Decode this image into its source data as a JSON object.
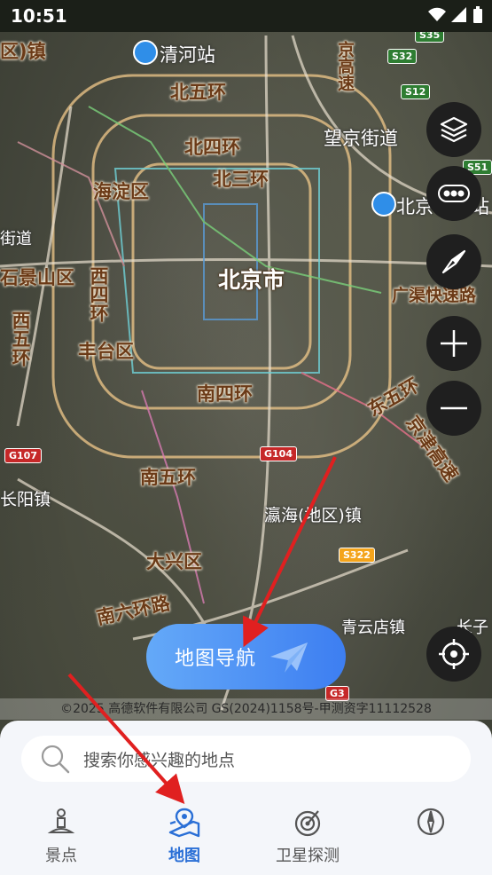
{
  "status_bar": {
    "time": "10:51"
  },
  "map": {
    "places": {
      "qinghe_station": "清河站",
      "north_5th_ring": "北五环",
      "north_4th_ring": "北四环",
      "north_3rd_ring": "北三环",
      "haidian": "海淀区",
      "beijing_city": "北京市",
      "shijingshan": "石景山区",
      "west_4th_ring": "西四环",
      "west_5th_ring": "西五环",
      "fengtai": "丰台区",
      "south_4th_ring": "南四环",
      "south_5th_ring": "南五环",
      "south_6th_ring": "南六环路",
      "daxing": "大兴区",
      "east_5th_ring": "东五环",
      "jingjin_highway": "京津高速",
      "guangqu_expressway": "广渠快速路",
      "wangjing_street": "望京街道",
      "beijing_chaoyang_station": "北京朝阳站",
      "yinghai": "瀛海(地区)镇",
      "changyang": "长阳镇",
      "qingyundian": "青云店镇",
      "changzi": "长子",
      "jingshi_highway": "京高速",
      "top_left_partial": "区)镇",
      "street_partial": "街道"
    },
    "shields": [
      "S35",
      "S32",
      "S12",
      "S51",
      "G107",
      "G104",
      "S322",
      "G3"
    ],
    "copyright": "©2025 高德软件有限公司 GS(2024)1158号-甲测资字11112528"
  },
  "controls": {
    "layers": "layers-icon",
    "traffic": "traffic-icon",
    "compass": "compass-icon",
    "zoom_in": "zoom-in-icon",
    "zoom_out": "zoom-out-icon",
    "locate": "locate-icon"
  },
  "nav_button": {
    "label": "地图导航"
  },
  "search": {
    "placeholder": "搜索你感兴趣的地点"
  },
  "tabs": [
    {
      "label": "景点",
      "icon": "attraction-icon",
      "active": false
    },
    {
      "label": "地图",
      "icon": "map-icon",
      "active": true
    },
    {
      "label": "卫星探测",
      "icon": "satellite-icon",
      "active": false
    },
    {
      "label": "",
      "icon": "compass-icon",
      "active": false
    }
  ],
  "colors": {
    "accent": "#2a6fd6",
    "annotation_arrow": "#e02020"
  }
}
